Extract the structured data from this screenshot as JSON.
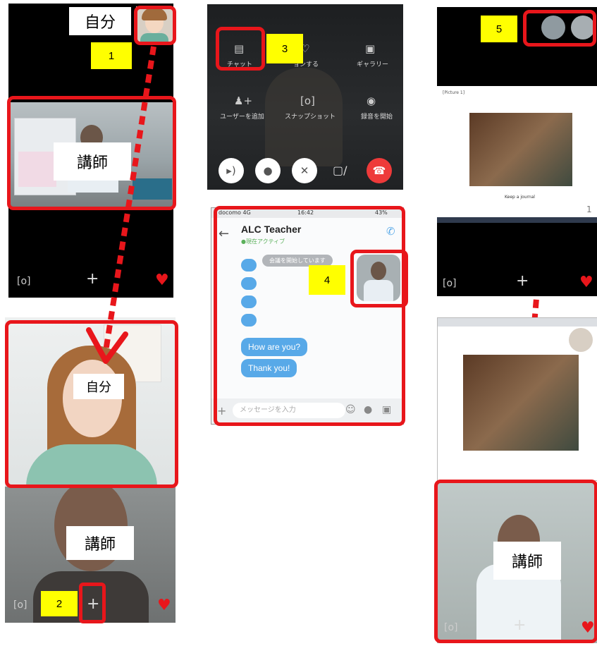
{
  "panel1": {
    "self_label": "自分",
    "callout_number": "1",
    "teacher_label": "講師"
  },
  "panel2": {
    "self_label": "自分",
    "teacher_label": "講師",
    "callout_number": "2"
  },
  "panel3": {
    "callout_number": "3",
    "menu": [
      {
        "label": "チャット",
        "icon": "chat-icon"
      },
      {
        "label": "ョンする",
        "icon": "reaction-icon"
      },
      {
        "label": "ギャラリー",
        "icon": "gallery-icon"
      },
      {
        "label": "ユーザーを追加",
        "icon": "add-user-icon"
      },
      {
        "label": "スナップショット",
        "icon": "snapshot-icon"
      },
      {
        "label": "録音を開始",
        "icon": "record-icon"
      }
    ]
  },
  "panel4": {
    "carrier": "docomo 4G",
    "time": "16:42",
    "battery": "43%",
    "contact_name": "ALC Teacher",
    "contact_status": "●現在アクティブ",
    "system_message": "会議を開始しています",
    "messages": [
      "How are you?",
      "Thank you!"
    ],
    "input_placeholder": "メッセージを入力",
    "callout_number": "4"
  },
  "panel5": {
    "callout_number": "5",
    "slide_caption": "Keep a journal",
    "slide_header": "[Picture 1]",
    "page_number": "1",
    "teacher_label": "講師"
  },
  "colors": {
    "highlight_red": "#e8161b",
    "callout_yellow": "#ffff00",
    "chat_blue": "#58a9e8"
  }
}
